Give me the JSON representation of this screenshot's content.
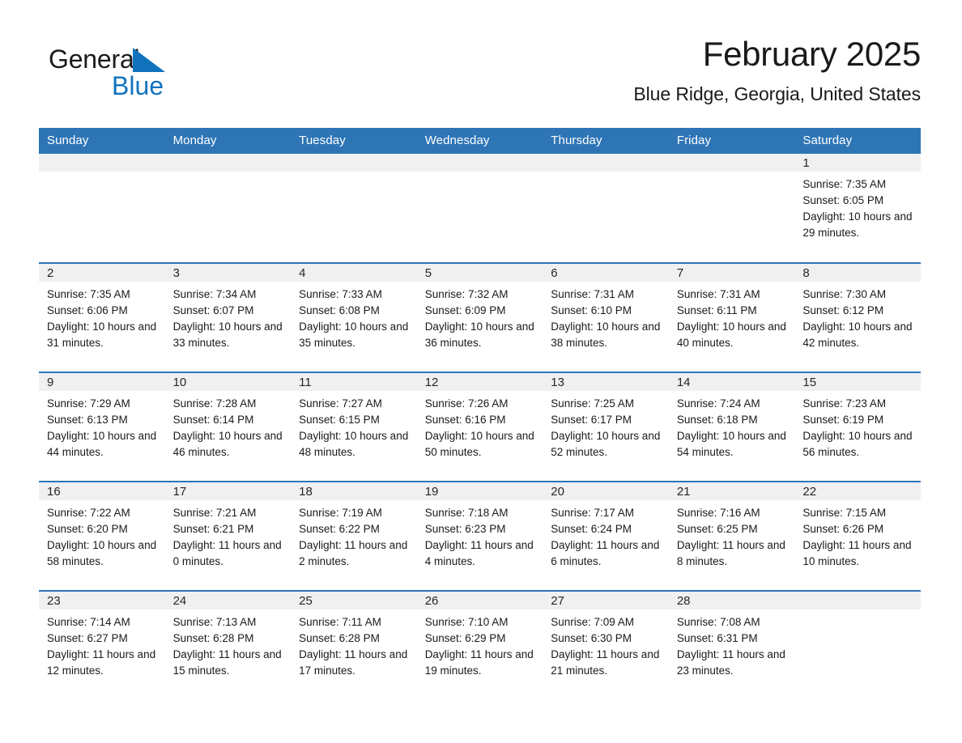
{
  "brand": {
    "name_part1": "General",
    "name_part2": "Blue",
    "triangle_color": "#1273bd",
    "blue_text_color": "#1273bd"
  },
  "header": {
    "title": "February 2025",
    "subtitle": "Blue Ridge, Georgia, United States"
  },
  "theme": {
    "header_blue": "#2e75b6",
    "daynum_band": "#f0f0f0",
    "row_separator": "#2e75b6"
  },
  "weekday_headers": [
    "Sunday",
    "Monday",
    "Tuesday",
    "Wednesday",
    "Thursday",
    "Friday",
    "Saturday"
  ],
  "weeks": [
    [
      {
        "day": "",
        "sunrise": "",
        "sunset": "",
        "daylight": "",
        "empty": true
      },
      {
        "day": "",
        "sunrise": "",
        "sunset": "",
        "daylight": "",
        "empty": true
      },
      {
        "day": "",
        "sunrise": "",
        "sunset": "",
        "daylight": "",
        "empty": true
      },
      {
        "day": "",
        "sunrise": "",
        "sunset": "",
        "daylight": "",
        "empty": true
      },
      {
        "day": "",
        "sunrise": "",
        "sunset": "",
        "daylight": "",
        "empty": true
      },
      {
        "day": "",
        "sunrise": "",
        "sunset": "",
        "daylight": "",
        "empty": true
      },
      {
        "day": "1",
        "sunrise": "Sunrise: 7:35 AM",
        "sunset": "Sunset: 6:05 PM",
        "daylight": "Daylight: 10 hours and 29 minutes.",
        "empty": false
      }
    ],
    [
      {
        "day": "2",
        "sunrise": "Sunrise: 7:35 AM",
        "sunset": "Sunset: 6:06 PM",
        "daylight": "Daylight: 10 hours and 31 minutes.",
        "empty": false
      },
      {
        "day": "3",
        "sunrise": "Sunrise: 7:34 AM",
        "sunset": "Sunset: 6:07 PM",
        "daylight": "Daylight: 10 hours and 33 minutes.",
        "empty": false
      },
      {
        "day": "4",
        "sunrise": "Sunrise: 7:33 AM",
        "sunset": "Sunset: 6:08 PM",
        "daylight": "Daylight: 10 hours and 35 minutes.",
        "empty": false
      },
      {
        "day": "5",
        "sunrise": "Sunrise: 7:32 AM",
        "sunset": "Sunset: 6:09 PM",
        "daylight": "Daylight: 10 hours and 36 minutes.",
        "empty": false
      },
      {
        "day": "6",
        "sunrise": "Sunrise: 7:31 AM",
        "sunset": "Sunset: 6:10 PM",
        "daylight": "Daylight: 10 hours and 38 minutes.",
        "empty": false
      },
      {
        "day": "7",
        "sunrise": "Sunrise: 7:31 AM",
        "sunset": "Sunset: 6:11 PM",
        "daylight": "Daylight: 10 hours and 40 minutes.",
        "empty": false
      },
      {
        "day": "8",
        "sunrise": "Sunrise: 7:30 AM",
        "sunset": "Sunset: 6:12 PM",
        "daylight": "Daylight: 10 hours and 42 minutes.",
        "empty": false
      }
    ],
    [
      {
        "day": "9",
        "sunrise": "Sunrise: 7:29 AM",
        "sunset": "Sunset: 6:13 PM",
        "daylight": "Daylight: 10 hours and 44 minutes.",
        "empty": false
      },
      {
        "day": "10",
        "sunrise": "Sunrise: 7:28 AM",
        "sunset": "Sunset: 6:14 PM",
        "daylight": "Daylight: 10 hours and 46 minutes.",
        "empty": false
      },
      {
        "day": "11",
        "sunrise": "Sunrise: 7:27 AM",
        "sunset": "Sunset: 6:15 PM",
        "daylight": "Daylight: 10 hours and 48 minutes.",
        "empty": false
      },
      {
        "day": "12",
        "sunrise": "Sunrise: 7:26 AM",
        "sunset": "Sunset: 6:16 PM",
        "daylight": "Daylight: 10 hours and 50 minutes.",
        "empty": false
      },
      {
        "day": "13",
        "sunrise": "Sunrise: 7:25 AM",
        "sunset": "Sunset: 6:17 PM",
        "daylight": "Daylight: 10 hours and 52 minutes.",
        "empty": false
      },
      {
        "day": "14",
        "sunrise": "Sunrise: 7:24 AM",
        "sunset": "Sunset: 6:18 PM",
        "daylight": "Daylight: 10 hours and 54 minutes.",
        "empty": false
      },
      {
        "day": "15",
        "sunrise": "Sunrise: 7:23 AM",
        "sunset": "Sunset: 6:19 PM",
        "daylight": "Daylight: 10 hours and 56 minutes.",
        "empty": false
      }
    ],
    [
      {
        "day": "16",
        "sunrise": "Sunrise: 7:22 AM",
        "sunset": "Sunset: 6:20 PM",
        "daylight": "Daylight: 10 hours and 58 minutes.",
        "empty": false
      },
      {
        "day": "17",
        "sunrise": "Sunrise: 7:21 AM",
        "sunset": "Sunset: 6:21 PM",
        "daylight": "Daylight: 11 hours and 0 minutes.",
        "empty": false
      },
      {
        "day": "18",
        "sunrise": "Sunrise: 7:19 AM",
        "sunset": "Sunset: 6:22 PM",
        "daylight": "Daylight: 11 hours and 2 minutes.",
        "empty": false
      },
      {
        "day": "19",
        "sunrise": "Sunrise: 7:18 AM",
        "sunset": "Sunset: 6:23 PM",
        "daylight": "Daylight: 11 hours and 4 minutes.",
        "empty": false
      },
      {
        "day": "20",
        "sunrise": "Sunrise: 7:17 AM",
        "sunset": "Sunset: 6:24 PM",
        "daylight": "Daylight: 11 hours and 6 minutes.",
        "empty": false
      },
      {
        "day": "21",
        "sunrise": "Sunrise: 7:16 AM",
        "sunset": "Sunset: 6:25 PM",
        "daylight": "Daylight: 11 hours and 8 minutes.",
        "empty": false
      },
      {
        "day": "22",
        "sunrise": "Sunrise: 7:15 AM",
        "sunset": "Sunset: 6:26 PM",
        "daylight": "Daylight: 11 hours and 10 minutes.",
        "empty": false
      }
    ],
    [
      {
        "day": "23",
        "sunrise": "Sunrise: 7:14 AM",
        "sunset": "Sunset: 6:27 PM",
        "daylight": "Daylight: 11 hours and 12 minutes.",
        "empty": false
      },
      {
        "day": "24",
        "sunrise": "Sunrise: 7:13 AM",
        "sunset": "Sunset: 6:28 PM",
        "daylight": "Daylight: 11 hours and 15 minutes.",
        "empty": false
      },
      {
        "day": "25",
        "sunrise": "Sunrise: 7:11 AM",
        "sunset": "Sunset: 6:28 PM",
        "daylight": "Daylight: 11 hours and 17 minutes.",
        "empty": false
      },
      {
        "day": "26",
        "sunrise": "Sunrise: 7:10 AM",
        "sunset": "Sunset: 6:29 PM",
        "daylight": "Daylight: 11 hours and 19 minutes.",
        "empty": false
      },
      {
        "day": "27",
        "sunrise": "Sunrise: 7:09 AM",
        "sunset": "Sunset: 6:30 PM",
        "daylight": "Daylight: 11 hours and 21 minutes.",
        "empty": false
      },
      {
        "day": "28",
        "sunrise": "Sunrise: 7:08 AM",
        "sunset": "Sunset: 6:31 PM",
        "daylight": "Daylight: 11 hours and 23 minutes.",
        "empty": false
      },
      {
        "day": "",
        "sunrise": "",
        "sunset": "",
        "daylight": "",
        "empty": true
      }
    ]
  ]
}
